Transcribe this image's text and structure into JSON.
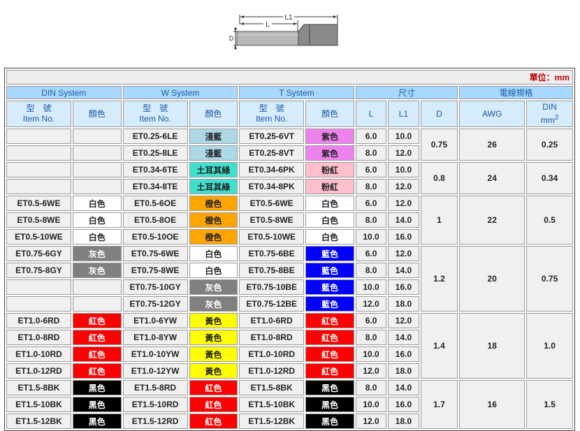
{
  "diagram": {
    "labels": {
      "l1": "L1",
      "l": "L",
      "d": "D"
    }
  },
  "unit_label": "單位：mm",
  "groups": [
    "DIN System",
    "W System",
    "T System",
    "尺寸",
    "電線規格"
  ],
  "headers": {
    "item_no_1": "型　號",
    "item_no_2": "Item No.",
    "color": "顏色",
    "l": "L",
    "l1": "L1",
    "d": "D",
    "awg": "AWG",
    "din": "DIN",
    "din_unit": "mm",
    "din_sup": "2"
  },
  "colors": {
    "light-blue": "#add8e6",
    "purple": "#ee82ee",
    "turquoise": "#40e0d0",
    "pink": "#ffc0cb",
    "white": "#ffffff",
    "orange": "#ffa500",
    "grey": "#808080",
    "blue": "#0000ff",
    "red": "#ff0000",
    "yellow": "#ffff00",
    "black": "#000000"
  },
  "rows": [
    {
      "din": "",
      "din_c": "",
      "din_k": "",
      "w": "ET0.25-6LE",
      "w_c": "淺藍",
      "w_k": "light-blue",
      "t": "ET0.25-6VT",
      "t_c": "紫色",
      "t_k": "purple",
      "l": "6.0",
      "l1": "10.0"
    },
    {
      "din": "",
      "din_c": "",
      "din_k": "",
      "w": "ET0.25-8LE",
      "w_c": "淺藍",
      "w_k": "light-blue",
      "t": "ET0.25-8VT",
      "t_c": "紫色",
      "t_k": "purple",
      "l": "8.0",
      "l1": "12.0"
    },
    {
      "din": "",
      "din_c": "",
      "din_k": "",
      "w": "ET0.34-6TE",
      "w_c": "土耳其綠",
      "w_k": "turquoise",
      "t": "ET0.34-6PK",
      "t_c": "粉紅",
      "t_k": "pink",
      "l": "6.0",
      "l1": "10.0"
    },
    {
      "din": "",
      "din_c": "",
      "din_k": "",
      "w": "ET0.34-8TE",
      "w_c": "土耳其綠",
      "w_k": "turquoise",
      "t": "ET0.34-8PK",
      "t_c": "粉紅",
      "t_k": "pink",
      "l": "8.0",
      "l1": "12.0"
    },
    {
      "din": "ET0.5-6WE",
      "din_c": "白色",
      "din_k": "white",
      "w": "ET0.5-6OE",
      "w_c": "橙色",
      "w_k": "orange",
      "t": "ET0.5-6WE",
      "t_c": "白色",
      "t_k": "white",
      "l": "6.0",
      "l1": "12.0"
    },
    {
      "din": "ET0.5-8WE",
      "din_c": "白色",
      "din_k": "white",
      "w": "ET0.5-8OE",
      "w_c": "橙色",
      "w_k": "orange",
      "t": "ET0.5-8WE",
      "t_c": "白色",
      "t_k": "white",
      "l": "8.0",
      "l1": "14.0"
    },
    {
      "din": "ET0.5-10WE",
      "din_c": "白色",
      "din_k": "white",
      "w": "ET0.5-10OE",
      "w_c": "橙色",
      "w_k": "orange",
      "t": "ET0.5-10WE",
      "t_c": "白色",
      "t_k": "white",
      "l": "10.0",
      "l1": "16.0"
    },
    {
      "din": "ET0.75-6GY",
      "din_c": "灰色",
      "din_k": "grey",
      "w": "ET0.75-6WE",
      "w_c": "白色",
      "w_k": "white",
      "t": "ET0.75-6BE",
      "t_c": "藍色",
      "t_k": "blue",
      "l": "6.0",
      "l1": "12.0"
    },
    {
      "din": "ET0.75-8GY",
      "din_c": "灰色",
      "din_k": "grey",
      "w": "ET0.75-8WE",
      "w_c": "白色",
      "w_k": "white",
      "t": "ET0.75-8BE",
      "t_c": "藍色",
      "t_k": "blue",
      "l": "8.0",
      "l1": "14.0"
    },
    {
      "din": "",
      "din_c": "",
      "din_k": "",
      "w": "ET0.75-10GY",
      "w_c": "灰色",
      "w_k": "grey",
      "t": "ET0.75-10BE",
      "t_c": "藍色",
      "t_k": "blue",
      "l": "10.0",
      "l1": "16.0"
    },
    {
      "din": "",
      "din_c": "",
      "din_k": "",
      "w": "ET0.75-12GY",
      "w_c": "灰色",
      "w_k": "grey",
      "t": "ET0.75-12BE",
      "t_c": "藍色",
      "t_k": "blue",
      "l": "12.0",
      "l1": "18.0"
    },
    {
      "din": "ET1.0-6RD",
      "din_c": "紅色",
      "din_k": "red",
      "w": "ET1.0-6YW",
      "w_c": "黃色",
      "w_k": "yellow",
      "t": "ET1.0-6RD",
      "t_c": "紅色",
      "t_k": "red",
      "l": "6.0",
      "l1": "12.0"
    },
    {
      "din": "ET1.0-8RD",
      "din_c": "紅色",
      "din_k": "red",
      "w": "ET1.0-8YW",
      "w_c": "黃色",
      "w_k": "yellow",
      "t": "ET1.0-8RD",
      "t_c": "紅色",
      "t_k": "red",
      "l": "8.0",
      "l1": "14.0"
    },
    {
      "din": "ET1.0-10RD",
      "din_c": "紅色",
      "din_k": "red",
      "w": "ET1.0-10YW",
      "w_c": "黃色",
      "w_k": "yellow",
      "t": "ET1.0-10RD",
      "t_c": "紅色",
      "t_k": "red",
      "l": "10.0",
      "l1": "16.0"
    },
    {
      "din": "ET1.0-12RD",
      "din_c": "紅色",
      "din_k": "red",
      "w": "ET1.0-12YW",
      "w_c": "黃色",
      "w_k": "yellow",
      "t": "ET1.0-12RD",
      "t_c": "紅色",
      "t_k": "red",
      "l": "12.0",
      "l1": "18.0"
    },
    {
      "din": "ET1.5-8BK",
      "din_c": "黑色",
      "din_k": "black",
      "w": "ET1.5-8RD",
      "w_c": "紅色",
      "w_k": "red",
      "t": "ET1.5-8BK",
      "t_c": "黑色",
      "t_k": "black",
      "l": "8.0",
      "l1": "14.0"
    },
    {
      "din": "ET1.5-10BK",
      "din_c": "黑色",
      "din_k": "black",
      "w": "ET1.5-10RD",
      "w_c": "紅色",
      "w_k": "red",
      "t": "ET1.5-10BK",
      "t_c": "黑色",
      "t_k": "black",
      "l": "10.0",
      "l1": "16.0"
    },
    {
      "din": "ET1.5-12BK",
      "din_c": "黑色",
      "din_k": "black",
      "w": "ET1.5-12RD",
      "w_c": "紅色",
      "w_k": "red",
      "t": "ET1.5-12BK",
      "t_c": "黑色",
      "t_k": "black",
      "l": "12.0",
      "l1": "18.0"
    }
  ],
  "dim_groups": [
    {
      "start": 0,
      "span": 2,
      "d": "0.75",
      "awg": "26",
      "din": "0.25"
    },
    {
      "start": 2,
      "span": 2,
      "d": "0.8",
      "awg": "24",
      "din": "0.34"
    },
    {
      "start": 4,
      "span": 3,
      "d": "1",
      "awg": "22",
      "din": "0.5"
    },
    {
      "start": 7,
      "span": 4,
      "d": "1.2",
      "awg": "20",
      "din": "0.75"
    },
    {
      "start": 11,
      "span": 4,
      "d": "1.4",
      "awg": "18",
      "din": "1.0"
    },
    {
      "start": 15,
      "span": 4,
      "d": "1.7",
      "awg": "16",
      "din": "1.5"
    }
  ]
}
